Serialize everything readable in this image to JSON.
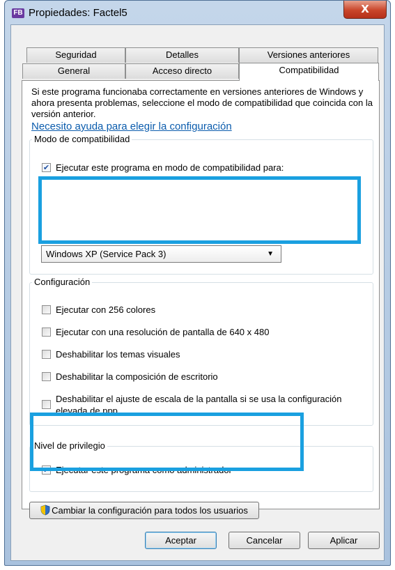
{
  "window": {
    "title": "Propiedades: Factel5",
    "app_icon": "FB",
    "close_glyph": "X"
  },
  "tabs": {
    "row_back": [
      "Seguridad",
      "Detalles",
      "Versiones anteriores"
    ],
    "row_front": [
      "General",
      "Acceso directo",
      "Compatibilidad"
    ],
    "selected": "Compatibilidad"
  },
  "intro_text": "Si este programa funcionaba correctamente en versiones anteriores de Windows y ahora presenta problemas, seleccione el modo de compatibilidad que coincida con la versión anterior.",
  "help_link": "Necesito ayuda para elegir la configuración",
  "compat_mode": {
    "label": "Modo de compatibilidad",
    "checkbox_label": "Ejecutar este programa en modo de compatibilidad para:",
    "checked": true,
    "selected_os": "Windows XP (Service Pack 3)"
  },
  "settings": {
    "label": "Configuración",
    "options": [
      {
        "label": "Ejecutar con 256 colores",
        "checked": false
      },
      {
        "label": "Ejecutar con una resolución de pantalla de 640 x 480",
        "checked": false
      },
      {
        "label": "Deshabilitar los temas visuales",
        "checked": false
      },
      {
        "label": "Deshabilitar la composición de escritorio",
        "checked": false
      },
      {
        "label": "Deshabilitar el ajuste de escala de la pantalla si se usa la configuración elevada de ppp",
        "checked": false
      }
    ]
  },
  "privilege": {
    "label": "Nivel de privilegio",
    "checkbox_label": "Ejecutar este programa como administrador",
    "checked": true
  },
  "all_users_button": "Cambiar la configuración para todos los usuarios",
  "buttons": {
    "ok": "Aceptar",
    "cancel": "Cancelar",
    "apply": "Aplicar"
  },
  "colors": {
    "highlight": "#1aa0e0",
    "link": "#0b5cad"
  }
}
